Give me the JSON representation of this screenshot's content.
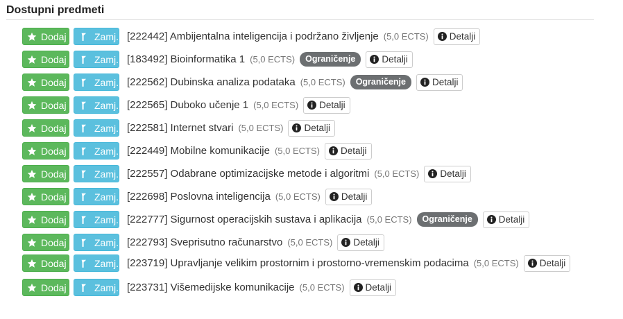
{
  "section": {
    "title": "Dostupni predmeti"
  },
  "buttons": {
    "add_label": "Dodaj",
    "swap_label": "Zamj.",
    "details_label": "Detalji",
    "add_icon": "star-icon",
    "swap_icon": "flag-icon",
    "details_icon": "info-circle-icon"
  },
  "colors": {
    "add": "#5cb85c",
    "swap": "#5bc0de",
    "badge": "#6c6f71"
  },
  "courses": [
    {
      "name": "[222442] Ambijentalna inteligencija i podržano življenje",
      "ects": "(5,0 ECTS)",
      "badge": ""
    },
    {
      "name": "[183492] Bioinformatika 1",
      "ects": "(5,0 ECTS)",
      "badge": "Ograničenje"
    },
    {
      "name": "[222562] Dubinska analiza podataka",
      "ects": "(5,0 ECTS)",
      "badge": "Ograničenje"
    },
    {
      "name": "[222565] Duboko učenje 1",
      "ects": "(5,0 ECTS)",
      "badge": ""
    },
    {
      "name": "[222581] Internet stvari",
      "ects": "(5,0 ECTS)",
      "badge": ""
    },
    {
      "name": "[222449] Mobilne komunikacije",
      "ects": "(5,0 ECTS)",
      "badge": ""
    },
    {
      "name": "[222557] Odabrane optimizacijske metode i algoritmi",
      "ects": "(5,0 ECTS)",
      "badge": ""
    },
    {
      "name": "[222698] Poslovna inteligencija",
      "ects": "(5,0 ECTS)",
      "badge": ""
    },
    {
      "name": "[222777] Sigurnost operacijskih sustava i aplikacija",
      "ects": "(5,0 ECTS)",
      "badge": "Ograničenje"
    },
    {
      "name": "[222793] Sveprisutno računarstvo",
      "ects": "(5,0 ECTS)",
      "badge": ""
    },
    {
      "name": "[223719] Upravljanje velikim prostornim i prostorno-vremenskim podacima",
      "ects": "(5,0 ECTS)",
      "badge": ""
    },
    {
      "name": "[223731] Višemedijske komunikacije",
      "ects": "(5,0 ECTS)",
      "badge": ""
    }
  ]
}
